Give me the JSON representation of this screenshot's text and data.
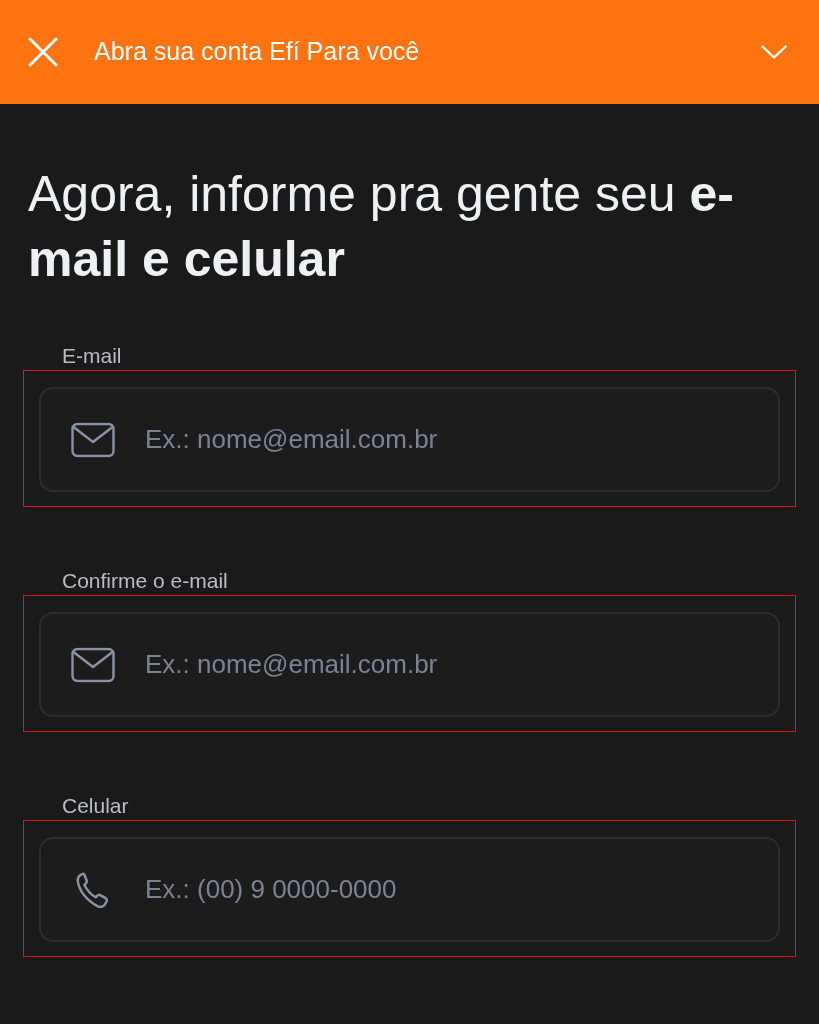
{
  "header": {
    "title": "Abra sua conta Efí Para você"
  },
  "heading": "Agora, informe pra gente seu **e-mail e celular**",
  "fields": [
    {
      "label": "E-mail",
      "kind": "email",
      "placeholder": "Ex.: nome@email.com.br",
      "highlighted": true
    },
    {
      "label": "Confirme o e-mail",
      "kind": "email",
      "placeholder": "Ex.: nome@email.com.br",
      "highlighted": true
    },
    {
      "label": "Celular",
      "kind": "phone",
      "placeholder": "Ex.: (00) 9 0000-0000",
      "highlighted": true
    }
  ]
}
